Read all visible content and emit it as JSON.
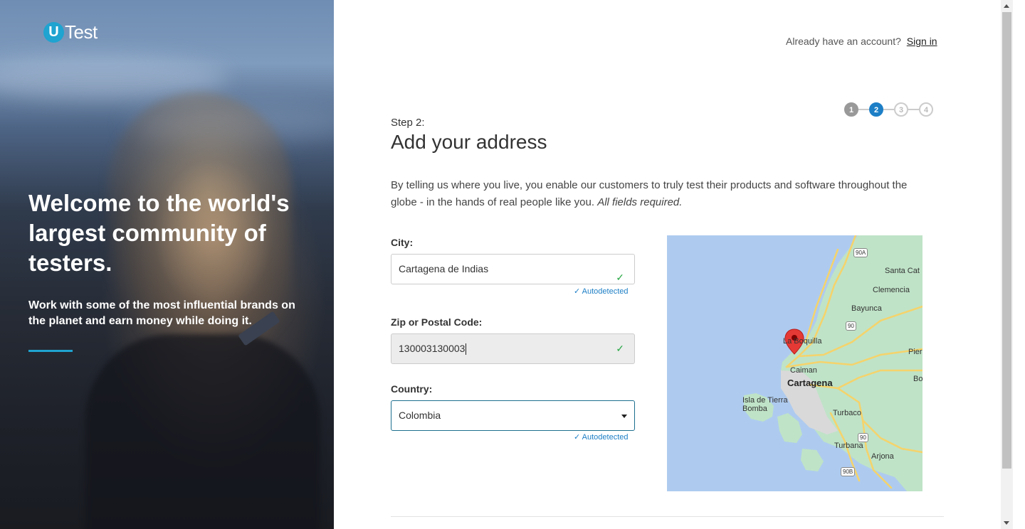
{
  "brand": {
    "badge": "U",
    "name": "Test"
  },
  "hero": {
    "title": "Welcome to the world's largest community of testers.",
    "subtitle": "Work with some of the most influential brands on the planet and earn money while doing it.",
    "accent": "#1fa3d0"
  },
  "header": {
    "prompt": "Already have an account?",
    "signin_label": "Sign in"
  },
  "stepper": {
    "steps": [
      "1",
      "2",
      "3",
      "4"
    ],
    "current": 2
  },
  "form": {
    "step_label": "Step 2:",
    "title": "Add your address",
    "intro": "By telling us where you live, you enable our customers to truly test their products and software throughout the globe - in the hands of real people like you.",
    "intro_em": "All fields required.",
    "city": {
      "label": "City:",
      "value": "Cartagena de Indias",
      "note": "Autodetected"
    },
    "zip": {
      "label": "Zip or Postal Code:",
      "value": "130003130003"
    },
    "country": {
      "label": "Country:",
      "value": "Colombia",
      "note": "Autodetected"
    }
  },
  "map": {
    "labels": [
      "Santa Cat",
      "Clemencia",
      "Bayunca",
      "La Boquilla",
      "Pier",
      "Caiman",
      "Cartagena",
      "Bogot",
      "Isla de Tierra Bomba",
      "Turbaco",
      "Turbana",
      "Arjona"
    ],
    "shields": [
      "90A",
      "90",
      "90",
      "90B"
    ],
    "colors": {
      "water": "#aecbef",
      "land": "#bfe3c7",
      "road": "#f5d36b",
      "pin": "#e53935"
    }
  }
}
